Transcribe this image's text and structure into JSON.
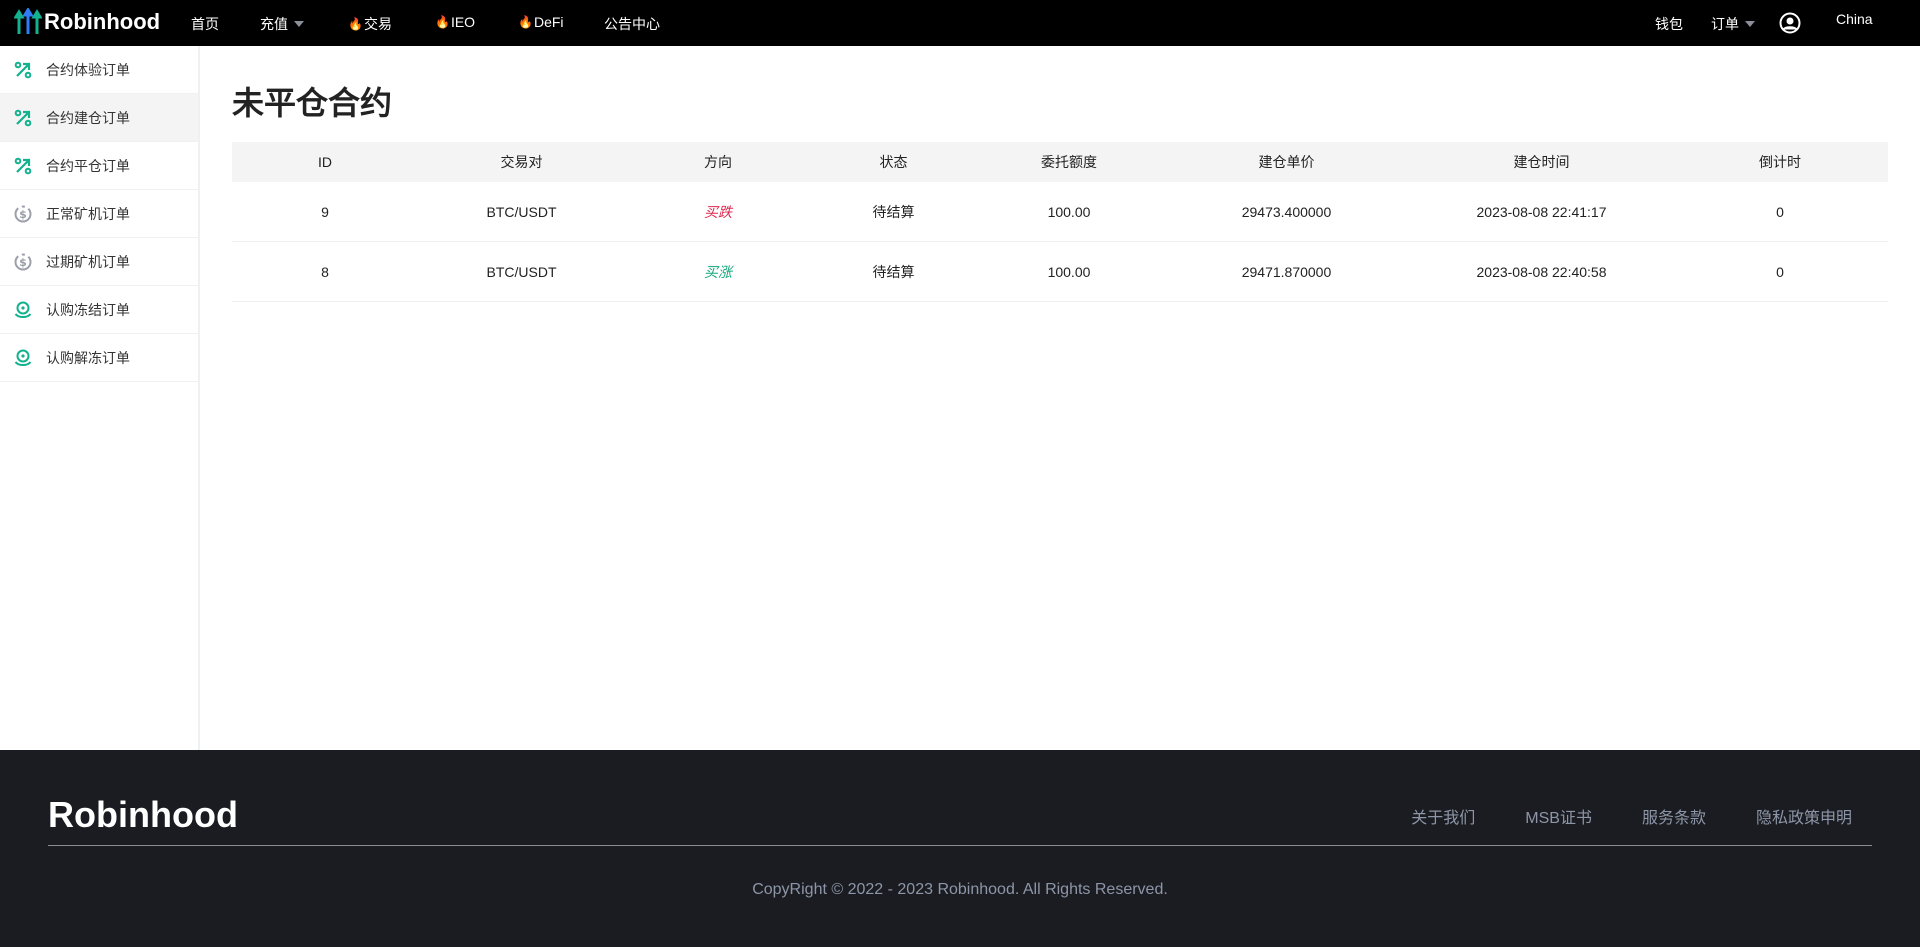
{
  "header": {
    "brand": "Robinhood",
    "nav": [
      {
        "label": "首页"
      },
      {
        "label": "充值",
        "dropdown": true
      },
      {
        "label": "交易",
        "hot": true
      },
      {
        "label": "IEO",
        "hot": true
      },
      {
        "label": "DeFi",
        "hot": true
      },
      {
        "label": "公告中心"
      }
    ],
    "wallet": "钱包",
    "orders": "订单",
    "language": "China"
  },
  "sidebar": {
    "items": [
      {
        "label": "合约体验订单",
        "icon": "percent-arrow-icon"
      },
      {
        "label": "合约建仓订单",
        "icon": "percent-arrow-icon",
        "active": true
      },
      {
        "label": "合约平仓订单",
        "icon": "percent-arrow-icon"
      },
      {
        "label": "正常矿机订单",
        "icon": "dollar-coin-icon"
      },
      {
        "label": "过期矿机订单",
        "icon": "dollar-coin-icon"
      },
      {
        "label": "认购冻结订单",
        "icon": "hand-coin-icon"
      },
      {
        "label": "认购解冻订单",
        "icon": "hand-coin-icon"
      }
    ]
  },
  "main": {
    "title": "未平仓合约",
    "columns": [
      "ID",
      "交易对",
      "方向",
      "状态",
      "委托额度",
      "建仓单价",
      "建仓时间",
      "倒计时"
    ],
    "rows": [
      {
        "id": "9",
        "pair": "BTC/USDT",
        "direction": "买跌",
        "status": "待结算",
        "amount": "100.00",
        "price": "29473.400000",
        "time": "2023-08-08 22:41:17",
        "countdown": "0"
      },
      {
        "id": "8",
        "pair": "BTC/USDT",
        "direction": "买涨",
        "status": "待结算",
        "amount": "100.00",
        "price": "29471.870000",
        "time": "2023-08-08 22:40:58",
        "countdown": "0"
      }
    ]
  },
  "footer": {
    "brand": "Robinhood",
    "links": [
      "关于我们",
      "MSB证书",
      "服务条款",
      "隐私政策申明"
    ],
    "copyright": "CopyRight © 2022 - 2023 Robinhood. All Rights Reserved."
  },
  "colors": {
    "down": "#e0284f",
    "up": "#13a77a",
    "accent": "#13b28f"
  }
}
